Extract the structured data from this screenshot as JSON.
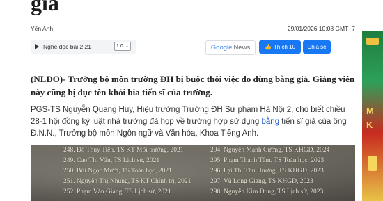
{
  "article": {
    "title_fragment": "giả",
    "author": "Yến Anh",
    "datetime": "29/01/2026 10:08 GMT+7",
    "audio": {
      "label": "Nghe đọc bài",
      "duration": "2:21",
      "speed": "1.0"
    },
    "google_news": {
      "google": "Google",
      "news": "News"
    },
    "facebook": {
      "like": "Thích 10",
      "share": "Chia sẻ"
    },
    "sapo": "(NLĐO)- Trưởng bộ môn trường ĐH bị buộc thôi việc do dùng bằng giả. Giảng viên này cũng bị đục tên khỏi bia tiến sĩ của trường.",
    "body": {
      "part1": "PGS-TS Nguyễn Quang Huy, Hiệu trưởng Trường ĐH Sư phạm Hà Nội 2, cho biết chiều 28-1 hội đồng kỷ luật nhà trường đã họp về trường hợp sử dụng ",
      "link": "bằng",
      "part2": " tiến sĩ giả của ông Đ.N.N., Trưởng bộ môn Ngôn ngữ và Văn hóa, Khoa Tiếng Anh."
    },
    "stele": {
      "left": [
        "248. Đỗ Thùy Tiên, TS KT Môi trường, 2021",
        "249. Cao Thị Vân, TS Lịch sử, 2021",
        "250. Bùi Ngọc Mười, TS Toán học, 2021",
        "251. Nguyễn Thị Nhung, TS KT Chính trị, 2021",
        "252. Phạm Văn Giang, TS Lịch sử, 2021"
      ],
      "right": [
        "294. Nguyễn Mạnh Cường, TS KHGD, 2024",
        "295. Phạm Thanh Tâm, TS Toán học, 2023",
        "296. Lại Thị Thu Hường, TS KHGD, 2023",
        "297. Vũ Long Giang, TS KHGD, 2023",
        "298. Nguyễn Kim Dung, TS Lịch sử, 2023"
      ]
    }
  },
  "colors": {
    "facebook": "#1877f2",
    "link": "#1a56c9"
  }
}
